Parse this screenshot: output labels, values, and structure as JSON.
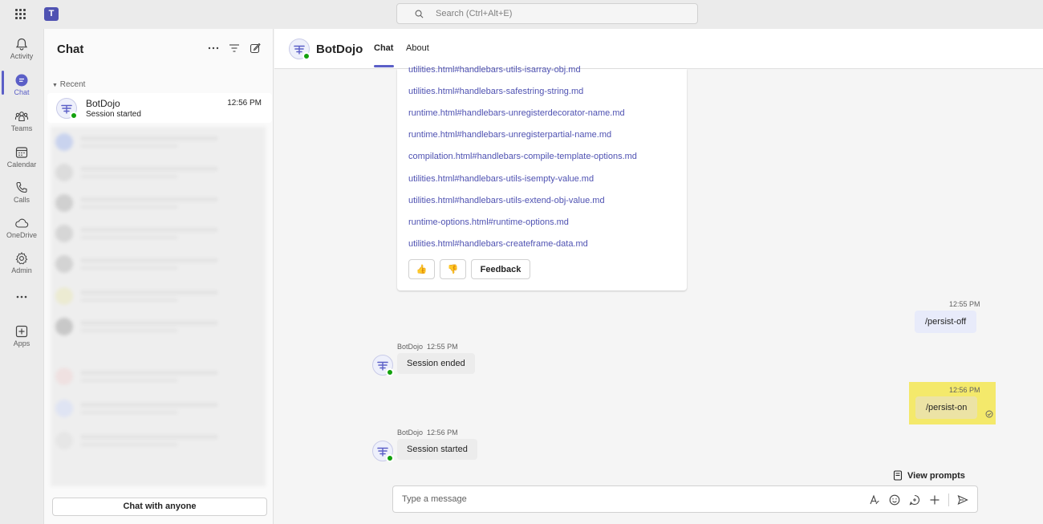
{
  "search": {
    "placeholder": "Search (Ctrl+Alt+E)"
  },
  "app": {
    "logo_letter": "T"
  },
  "rail": [
    {
      "label": "Activity",
      "icon": "bell-icon"
    },
    {
      "label": "Chat",
      "icon": "chat-icon",
      "active": true
    },
    {
      "label": "Teams",
      "icon": "teams-icon"
    },
    {
      "label": "Calendar",
      "icon": "calendar-icon"
    },
    {
      "label": "Calls",
      "icon": "phone-icon"
    },
    {
      "label": "OneDrive",
      "icon": "cloud-icon"
    },
    {
      "label": "Admin",
      "icon": "gear-icon"
    },
    {
      "label": "Apps",
      "icon": "add-icon"
    }
  ],
  "chat_list": {
    "title": "Chat",
    "section": "Recent",
    "items": [
      {
        "name": "BotDojo",
        "preview": "Session started",
        "time": "12:56 PM"
      }
    ],
    "footer_button": "Chat with anyone"
  },
  "header": {
    "name": "BotDojo",
    "tabs": [
      "Chat",
      "About"
    ],
    "active_tab": "Chat"
  },
  "card": {
    "links": [
      "utilities.html#handlebars-utils-isarray-obj.md",
      "utilities.html#handlebars-safestring-string.md",
      "runtime.html#handlebars-unregisterdecorator-name.md",
      "runtime.html#handlebars-unregisterpartial-name.md",
      "compilation.html#handlebars-compile-template-options.md",
      "utilities.html#handlebars-utils-isempty-value.md",
      "utilities.html#handlebars-utils-extend-obj-value.md",
      "runtime-options.html#runtime-options.md",
      "utilities.html#handlebars-createframe-data.md"
    ],
    "thumbs_up": "👍",
    "thumbs_down": "👎",
    "feedback_label": "Feedback"
  },
  "messages": [
    {
      "from": "me",
      "time": "12:55 PM",
      "text": "/persist-off"
    },
    {
      "from": "bot",
      "sender": "BotDojo",
      "time": "12:55 PM",
      "text": "Session ended"
    },
    {
      "from": "me",
      "time": "12:56 PM",
      "text": "/persist-on",
      "highlight": "#f4e96b"
    },
    {
      "from": "bot",
      "sender": "BotDojo",
      "time": "12:56 PM",
      "text": "Session started"
    }
  ],
  "view_prompts": "View prompts",
  "composer": {
    "placeholder": "Type a message"
  },
  "colors": {
    "accent": "#5b5fc7",
    "link": "#4f52b2",
    "online": "#13a10e",
    "highlight": "#f4e96b"
  }
}
